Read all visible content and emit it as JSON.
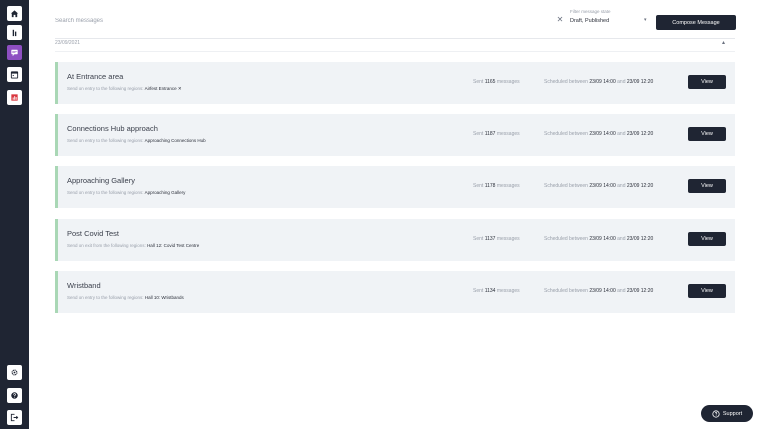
{
  "header": {
    "search_placeholder": "Search messages",
    "clear_icon": "close-icon",
    "clear_glyph": "✕",
    "filter_label": "Filter message state",
    "filter_value": "Draft, Published",
    "filter_chevron": "▾",
    "compose_label": "Compose Message"
  },
  "group": {
    "date": "23/09/2021",
    "chevron": "▴"
  },
  "sidebar": {
    "items": [
      {
        "icon": "home-icon",
        "active": false
      },
      {
        "icon": "bar-chart-icon",
        "active": false
      },
      {
        "icon": "message-icon",
        "active": true
      },
      {
        "icon": "calendar-icon",
        "active": false
      },
      {
        "icon": "analytics-icon",
        "active": false
      }
    ],
    "bottom": [
      {
        "icon": "gear-icon"
      },
      {
        "icon": "help-icon"
      },
      {
        "icon": "logout-icon"
      }
    ],
    "active_color": "#8e4fc2"
  },
  "messages": [
    {
      "title": "At Entrance area",
      "sub_prefix": "Send on entry to the following regions:",
      "region": "Airfest Entrance ✕",
      "sent_prefix": "Sent",
      "sent_count": "1165",
      "sent_suffix": "messages",
      "sched_prefix": "Scheduled between",
      "start": "23/09 14:00",
      "and": "and",
      "end": "23/09 12:20",
      "view_label": "View"
    },
    {
      "title": "Connections Hub approach",
      "sub_prefix": "Send on entry to the following regions:",
      "region": "Approaching Connections Hub",
      "sent_prefix": "Sent",
      "sent_count": "1187",
      "sent_suffix": "messages",
      "sched_prefix": "Scheduled between",
      "start": "23/09 14:00",
      "and": "and",
      "end": "23/09 12:20",
      "view_label": "View"
    },
    {
      "title": "Approaching Gallery",
      "sub_prefix": "Send on entry to the following regions:",
      "region": "Approaching Gallery",
      "sent_prefix": "Sent",
      "sent_count": "1178",
      "sent_suffix": "messages",
      "sched_prefix": "Scheduled between",
      "start": "23/09 14:00",
      "and": "and",
      "end": "23/09 12:20",
      "view_label": "View"
    },
    {
      "title": "Post Covid Test",
      "sub_prefix": "Send on exit from the following regions:",
      "region": "Hall 12: Covid Test Centre",
      "sent_prefix": "Sent",
      "sent_count": "1137",
      "sent_suffix": "messages",
      "sched_prefix": "Scheduled between",
      "start": "23/09 14:00",
      "and": "and",
      "end": "23/09 12:20",
      "view_label": "View"
    },
    {
      "title": "Wristband",
      "sub_prefix": "Send on entry to the following regions:",
      "region": "Hall 10: Wristbands",
      "sent_prefix": "Sent",
      "sent_count": "1134",
      "sent_suffix": "messages",
      "sched_prefix": "Scheduled between",
      "start": "23/09 14:00",
      "and": "and",
      "end": "23/09 12:20",
      "view_label": "View"
    }
  ],
  "support_label": "Support",
  "colors": {
    "sidebar_bg": "#1f2533",
    "card_bg": "#f0f3f6",
    "card_accent": "#a9d7b5"
  }
}
